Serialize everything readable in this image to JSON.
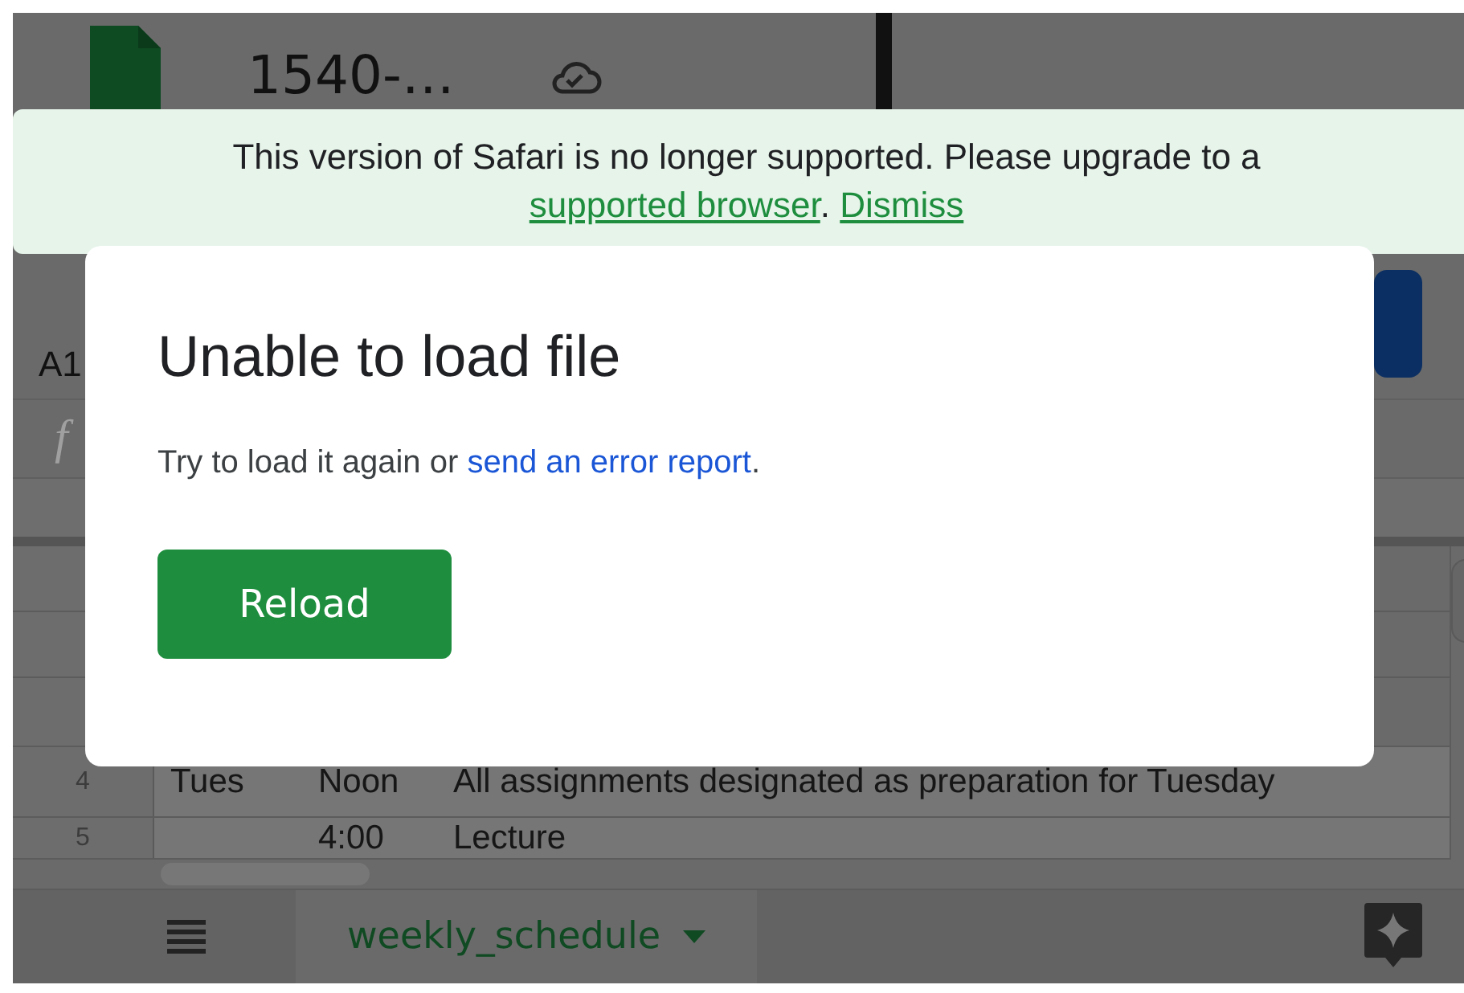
{
  "header": {
    "file_title": "1540-…"
  },
  "name_box": "A1",
  "formula_label": "f",
  "rows": [
    {},
    {},
    {},
    {
      "number": "4",
      "day": "Tues",
      "time": "Noon",
      "description": "All assignments designated as preparation for Tuesday"
    },
    {
      "number": "5",
      "time": "4:00",
      "description": "Lecture"
    }
  ],
  "sheet_tabs": [
    {
      "label": "weekly_schedule",
      "selected": true
    }
  ],
  "banner": {
    "message": "This version of Safari is no longer supported. Please upgrade to a",
    "link": "supported browser",
    "after_link": ".",
    "dismiss": "Dismiss"
  },
  "dialog": {
    "title": "Unable to load file",
    "message": "Try to load it again or",
    "link": "send an error report",
    "after_link": ".",
    "button": "Reload"
  }
}
